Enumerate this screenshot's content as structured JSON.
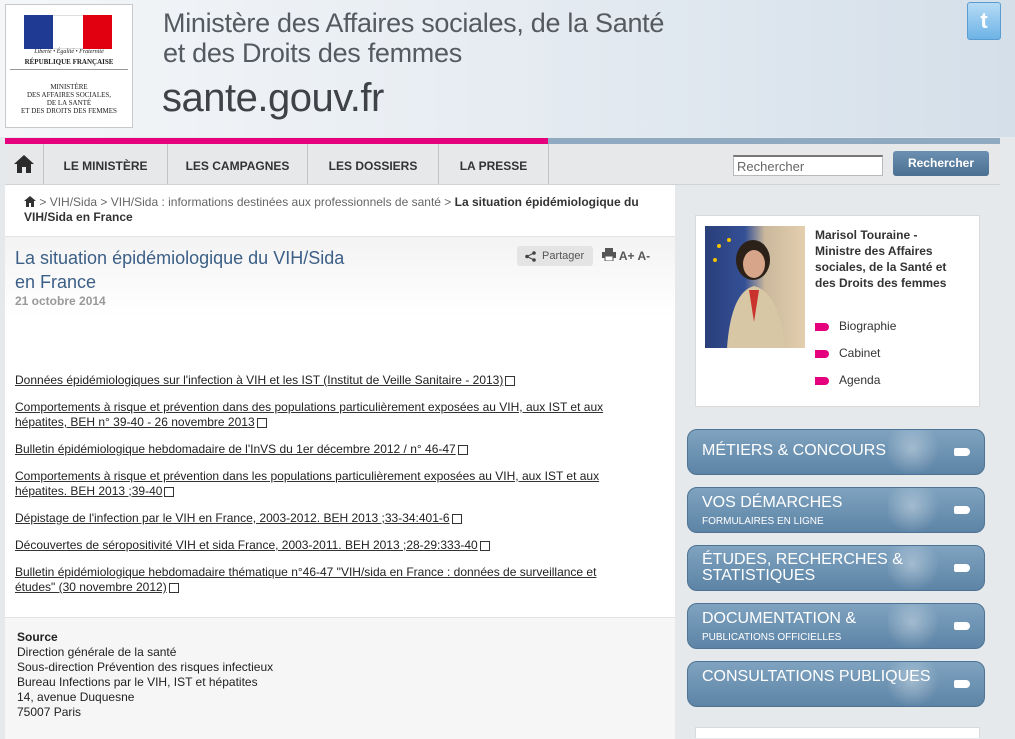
{
  "header": {
    "logo": {
      "motto": "Liberté • Égalité • Fraternité",
      "republic": "RÉPUBLIQUE FRANÇAISE",
      "ministry_lines": [
        "MINISTÈRE",
        "DES AFFAIRES SOCIALES,",
        "DE LA SANTÉ",
        "ET DES DROITS DES FEMMES"
      ]
    },
    "title_line1": "Ministère des Affaires sociales, de la Santé",
    "title_line2": "et des Droits des femmes",
    "domain": "sante.gouv.fr",
    "twitter_icon": "twitter-icon"
  },
  "nav": {
    "items": [
      "LE MINISTÈRE",
      "LES CAMPAGNES",
      "LES DOSSIERS",
      "LA PRESSE"
    ],
    "search_placeholder": "Rechercher",
    "search_button": "Rechercher"
  },
  "breadcrumb": {
    "items": [
      "VIH/Sida",
      "VIH/Sida : informations destinées aux professionnels de santé"
    ],
    "current": "La situation épidémiologique du VIH/Sida en France",
    "separator": ">"
  },
  "article": {
    "title": "La situation épidémiologique du VIH/Sida en France",
    "date": "21 octobre 2014",
    "share_label": "Partager",
    "font_increase": "A+",
    "font_decrease": "A-",
    "links": [
      "Données épidémiologiques sur l'infection à VIH et les IST (Institut de Veille Sanitaire - 2013)",
      "Comportements à risque et prévention dans des populations particulièrement exposées au VIH, aux IST et aux hépatites, BEH n° 39-40 - 26 novembre 2013",
      "Bulletin épidémiologique hebdomadaire de l'InVS du 1er décembre 2012 / n° 46-47",
      "Comportements à risque et prévention dans les populations particulièrement exposées au VIH, aux IST et aux hépatites. BEH 2013 ;39-40",
      "Dépistage de l'infection par le VIH en France, 2003-2012. BEH 2013 ;33-34:401-6",
      "Découvertes de séropositivité VIH et sida France, 2003-2011. BEH 2013 ;28-29:333-40",
      "Bulletin épidémiologique hebdomadaire thématique n°46-47 \"VIH/sida en France : données de surveillance et études\" (30 novembre 2012)"
    ]
  },
  "source": {
    "heading": "Source",
    "lines": [
      "Direction générale de la santé",
      "Sous-direction Prévention des risques infectieux",
      "Bureau Infections par le VIH, IST et hépatites",
      "14, avenue Duquesne",
      "75007 Paris"
    ]
  },
  "minister": {
    "name": "Marisol Touraine - Ministre des Affaires sociales, de la Santé et des Droits des femmes",
    "links": [
      "Biographie",
      "Cabinet",
      "Agenda"
    ]
  },
  "sidebar_buttons": [
    {
      "title": "MÉTIERS & CONCOURS",
      "subtitle": ""
    },
    {
      "title": "VOS DÉMARCHES",
      "subtitle": "FORMULAIRES EN LIGNE"
    },
    {
      "title": "ÉTUDES, RECHERCHES & STATISTIQUES",
      "subtitle": ""
    },
    {
      "title": "DOCUMENTATION &",
      "subtitle": "PUBLICATIONS OFFICIELLES"
    },
    {
      "title": "CONSULTATIONS PUBLIQUES",
      "subtitle": ""
    }
  ],
  "colors": {
    "accent_pink": "#e5007e",
    "title_blue": "#3b5f86",
    "button_blue": "#5d84a6"
  }
}
